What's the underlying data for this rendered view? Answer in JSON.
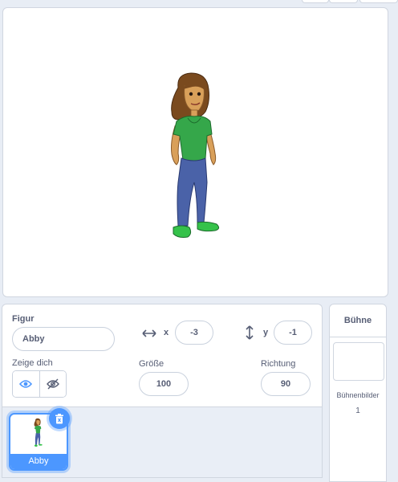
{
  "sprite_info": {
    "label_sprite": "Figur",
    "sprite_name": "Abby",
    "x_label": "x",
    "x_value": "-3",
    "y_label": "y",
    "y_value": "-1",
    "label_show": "Zeige dich",
    "label_size": "Größe",
    "size_value": "100",
    "label_direction": "Richtung",
    "direction_value": "90"
  },
  "sprite_list": {
    "items": [
      {
        "name": "Abby"
      }
    ]
  },
  "stage_panel": {
    "title": "Bühne",
    "backdrops_label": "Bühnenbilder",
    "backdrops_count": "1"
  },
  "colors": {
    "accent": "#4c97ff",
    "text": "#575e75",
    "shirt": "#35a74a",
    "jeans": "#4a62a8",
    "hair": "#7a4a1e",
    "skin": "#d9a05a"
  }
}
